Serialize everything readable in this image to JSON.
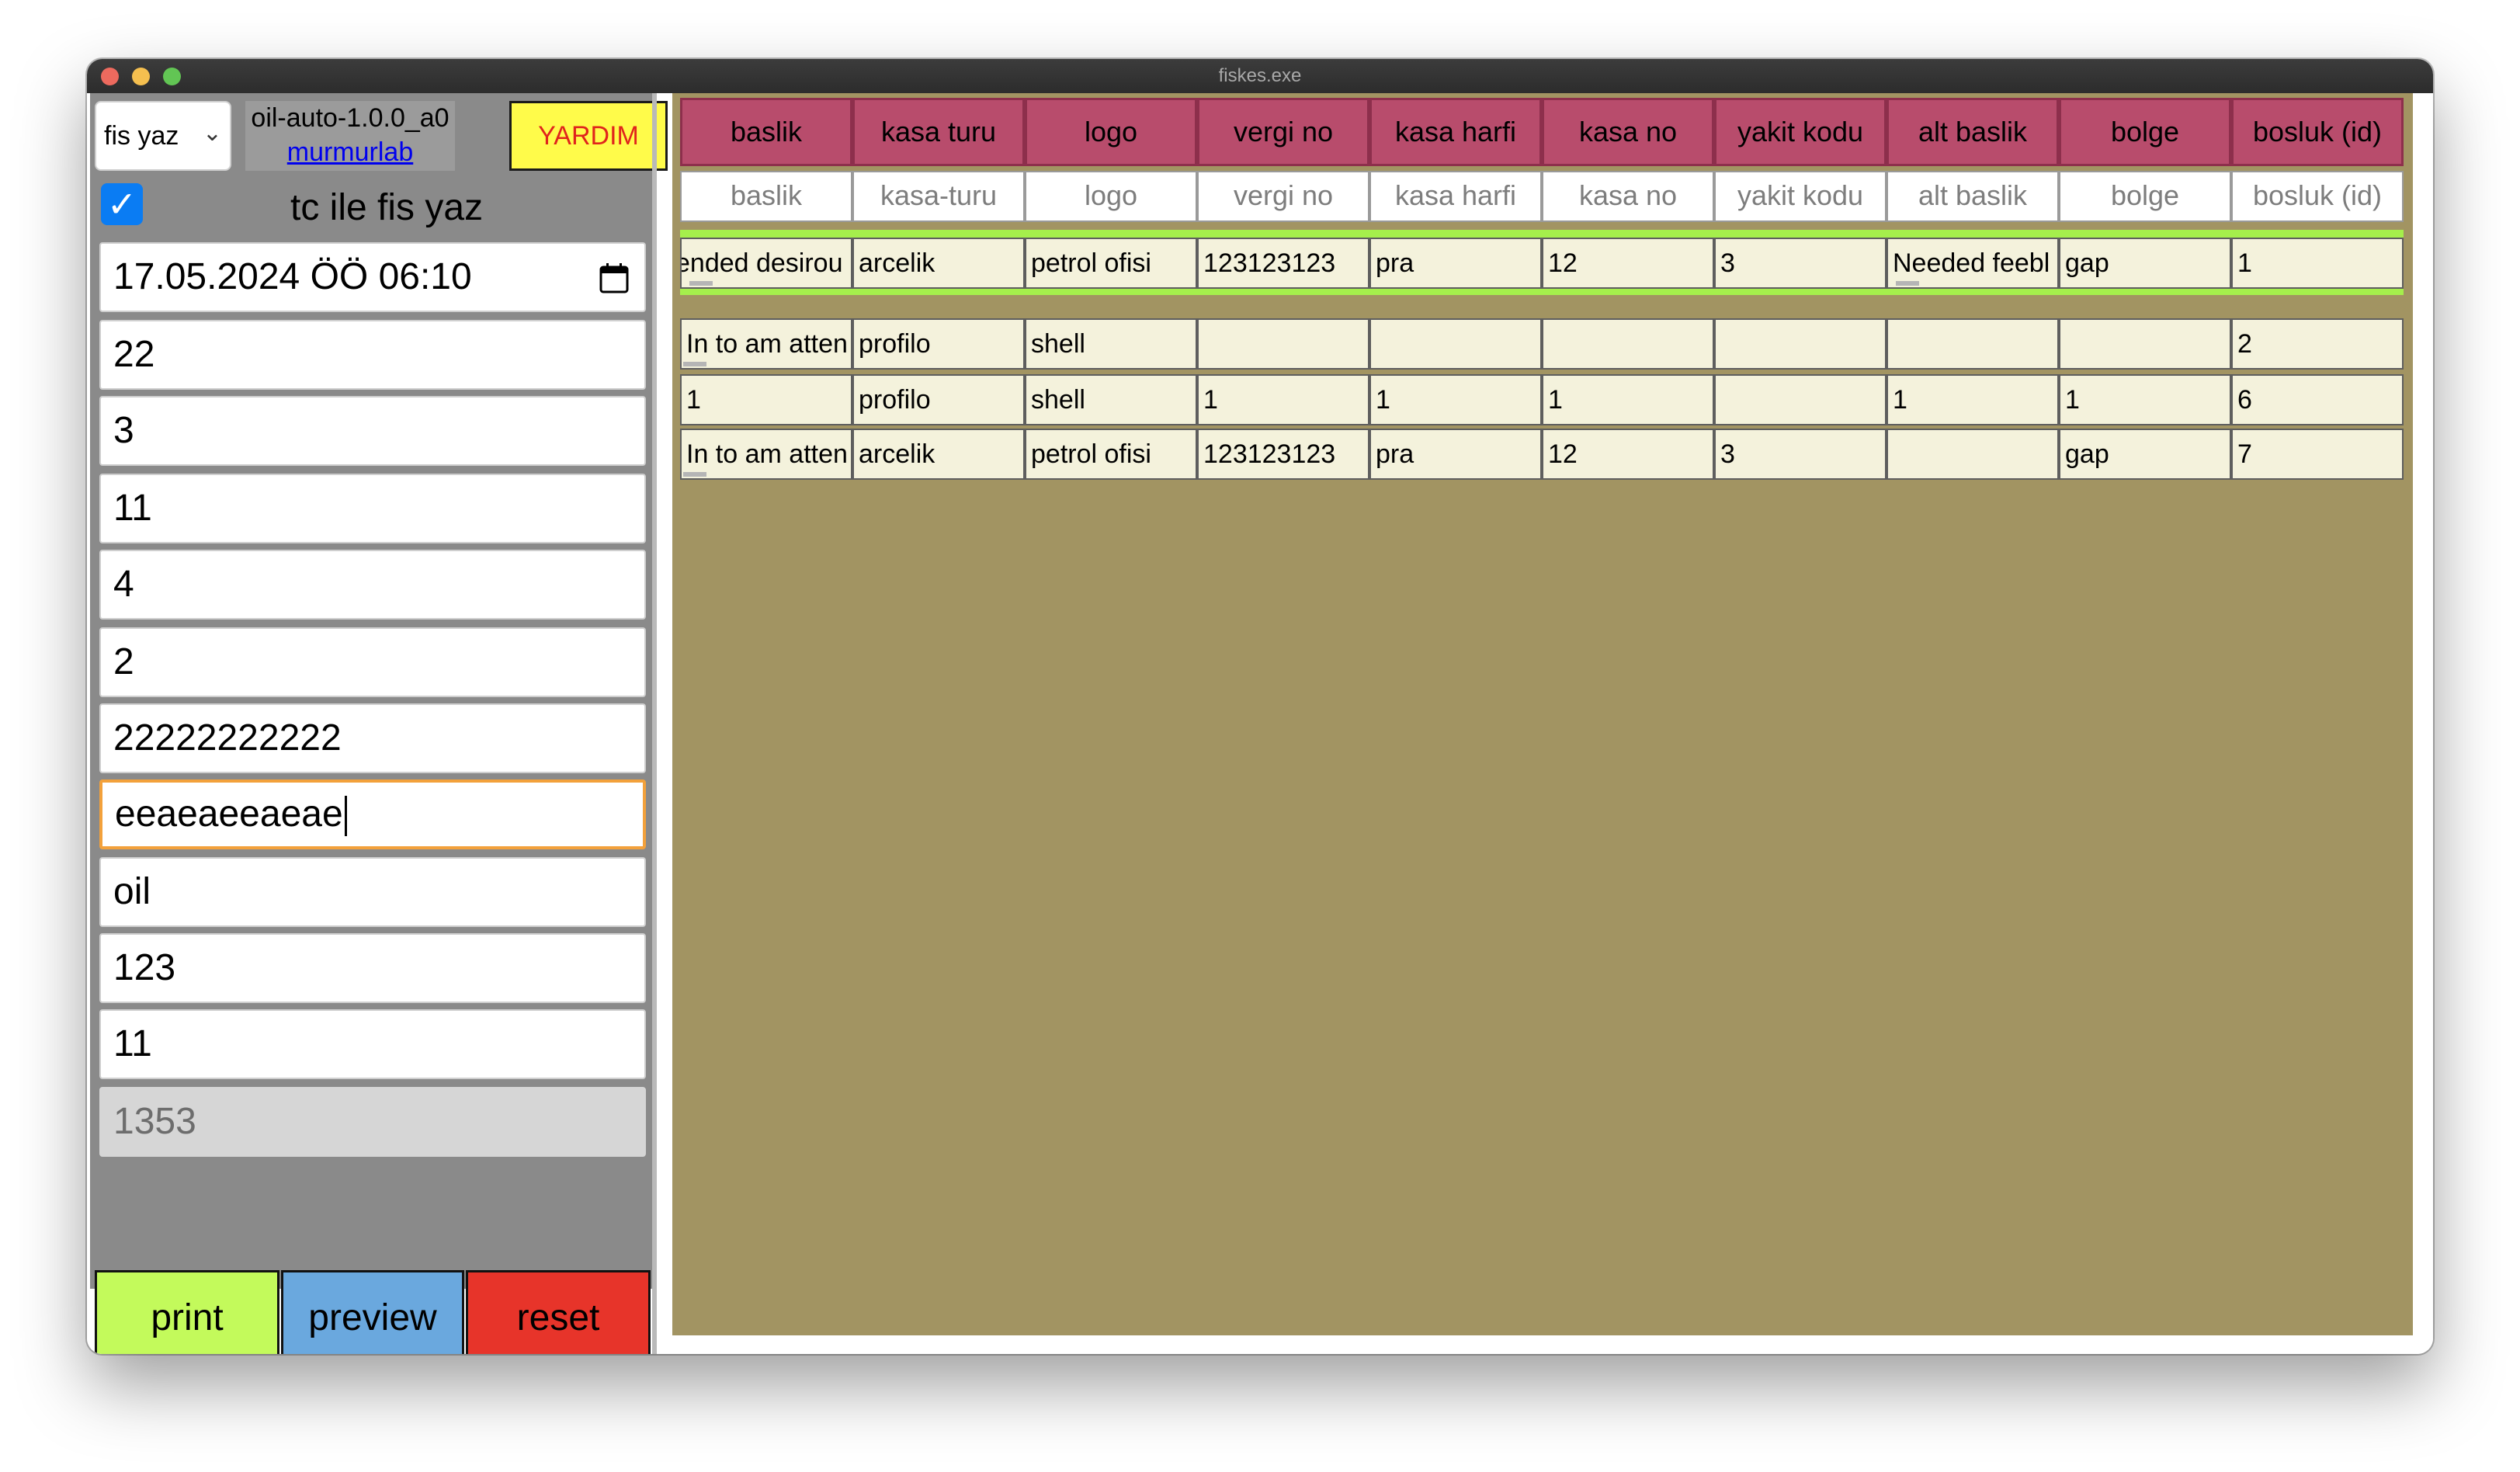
{
  "window": {
    "title": "fiskes.exe"
  },
  "left": {
    "mode_select": "fis yaz",
    "version": "oil-auto-1.0.0_a0",
    "author_link": "murmurlab",
    "help_button": "YARDIM",
    "checkbox_checked": true,
    "checkbox_label": "tc ile fis yaz",
    "datetime": "17.05.2024 ÖÖ 06:10",
    "fields": [
      "22",
      "3",
      "11",
      "4",
      "2",
      "22222222222",
      "eeaeaeeaeae",
      "oil",
      "123",
      "11"
    ],
    "disabled_field": "1353",
    "buttons": {
      "print": "print",
      "preview": "preview",
      "reset": "reset"
    },
    "colors": {
      "print": "#c3fa5b",
      "preview": "#6aa8de",
      "reset": "#e7342a",
      "help": "#fffb4a"
    }
  },
  "table": {
    "headers": [
      "baslik",
      "kasa turu",
      "logo",
      "vergi no",
      "kasa harfi",
      "kasa no",
      "yakit kodu",
      "alt baslik",
      "bolge",
      "bosluk (id)"
    ],
    "filters": [
      "baslik",
      "kasa-turu",
      "logo",
      "vergi no",
      "kasa harfi",
      "kasa no",
      "yakit kodu",
      "alt baslik",
      "bolge",
      "bosluk (id)"
    ],
    "rows": [
      [
        "ended desirou",
        "arcelik",
        "petrol ofisi",
        "123123123",
        "pra",
        "12",
        "3",
        "Needed feebl",
        "gap",
        "1"
      ],
      [
        "In to am atten",
        "profilo",
        "shell",
        "",
        "",
        "",
        "",
        "",
        "",
        "2"
      ],
      [
        "1",
        "profilo",
        "shell",
        "1",
        "1",
        "1",
        "",
        "1",
        "1",
        "6"
      ],
      [
        "In to am atten",
        "arcelik",
        "petrol ofisi",
        "123123123",
        "pra",
        "12",
        "3",
        "",
        "gap",
        "7"
      ]
    ],
    "colors": {
      "header": "#b84c6c",
      "row": "#f4f2dc",
      "background": "#a29462",
      "selected": "#a5ef4c"
    }
  }
}
